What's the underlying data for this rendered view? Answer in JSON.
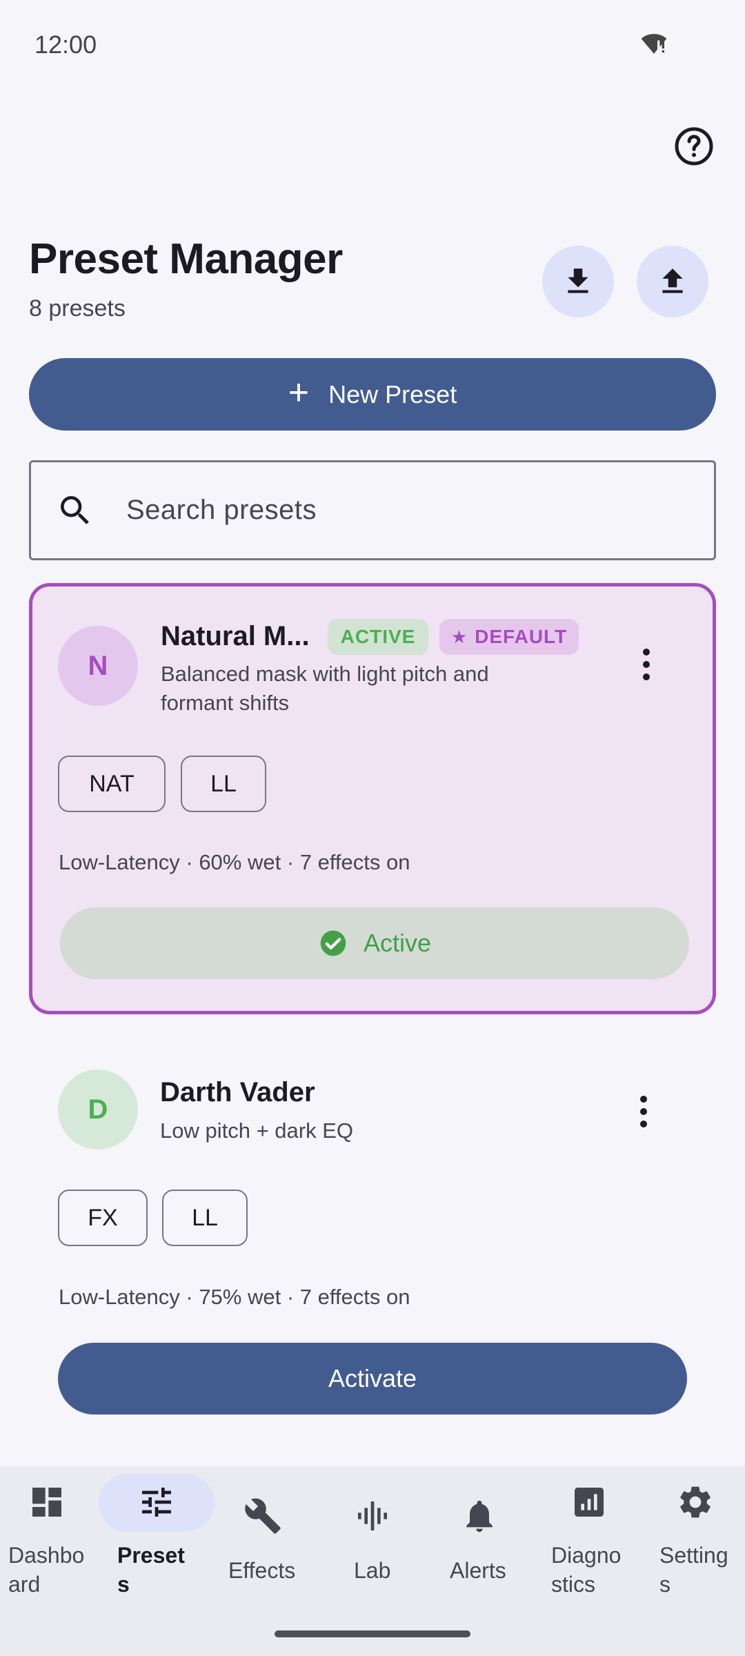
{
  "status_bar": {
    "time": "12:00",
    "wifi_icon": "wifi-alert-icon"
  },
  "header": {
    "title": "Preset Manager",
    "subtitle": "8 presets",
    "help_icon": "help-circle-icon",
    "import_icon": "download-icon",
    "export_icon": "upload-icon"
  },
  "new_preset": {
    "label": "New Preset",
    "icon": "plus-icon"
  },
  "search": {
    "placeholder": "Search presets",
    "icon": "search-icon"
  },
  "presets": [
    {
      "avatar_letter": "N",
      "name": "Natural M...",
      "badges": {
        "active": "ACTIVE",
        "default": "DEFAULT"
      },
      "description": "Balanced mask with light pitch and formant shifts",
      "tags": [
        "NAT",
        "LL"
      ],
      "stats": "Low-Latency · 60% wet · 7 effects on",
      "button_label": "Active",
      "is_active": true
    },
    {
      "avatar_letter": "D",
      "name": "Darth Vader",
      "description": "Low pitch + dark EQ",
      "tags": [
        "FX",
        "LL"
      ],
      "stats": "Low-Latency · 75% wet · 7 effects on",
      "button_label": "Activate",
      "is_active": false
    }
  ],
  "bottom_nav": {
    "selected": "Presets",
    "items": [
      {
        "label": "Dashbo\nard",
        "icon": "dashboard-icon"
      },
      {
        "label": "Preset\ns",
        "icon": "tune-icon"
      },
      {
        "label": "Effects",
        "icon": "wrench-icon"
      },
      {
        "label": "Lab",
        "icon": "waveform-icon"
      },
      {
        "label": "Alerts",
        "icon": "bell-icon"
      },
      {
        "label": "Diagno\nstics",
        "icon": "diagnostics-icon"
      },
      {
        "label": "Setting\ns",
        "icon": "gear-icon"
      }
    ]
  },
  "colors": {
    "primary": "#435c90",
    "active_border": "#a64dbe",
    "active_card_bg": "#f0e3f4",
    "active_green": "#43a047",
    "nav_pill": "#dde1f9"
  }
}
